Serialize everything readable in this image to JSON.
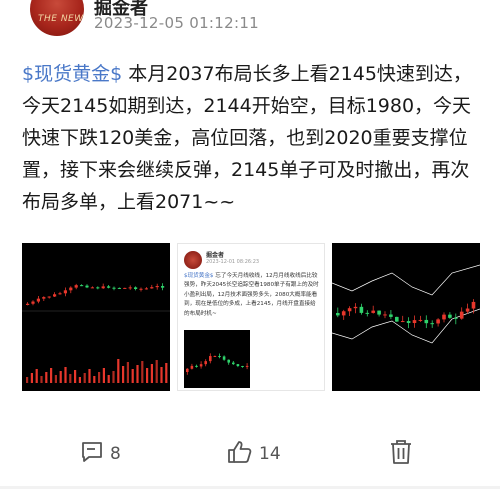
{
  "post": {
    "author": "掘金者",
    "timestamp": "2023-12-05 01:12:11",
    "avatar_text": "THE NEW",
    "tag": "$现货黄金$",
    "text": " 本月2037布局长多上看2145快速到达，今天2145如期到达，2144开始空，目标1980，今天快速下跌120美金，高位回落，也到2020重要支撑位置，接下来会继续反弹，2145单子可及时撤出，再次布局多单，上看2071~~"
  },
  "thumbnail_post": {
    "author": "掘金者",
    "timestamp": "2023-12-01 08:26:23",
    "tag": "$现货黄金$",
    "text": " 忘了今天月线收线，12月月线收线后比较强势，昨天2045长空追踪空看1980单子有跟上的及时小盈利出局，12月技术面强势多头，2080大概率能看到，现在是低位的多成，上看2145，月线开盘直接给的布局时机~"
  },
  "actions": {
    "comment_count": "8",
    "like_count": "14"
  },
  "colors": {
    "tag": "#4a78c8",
    "candle_up": "#e8372c",
    "candle_down": "#2fd36b",
    "timestamp": "#8a8a8a"
  }
}
